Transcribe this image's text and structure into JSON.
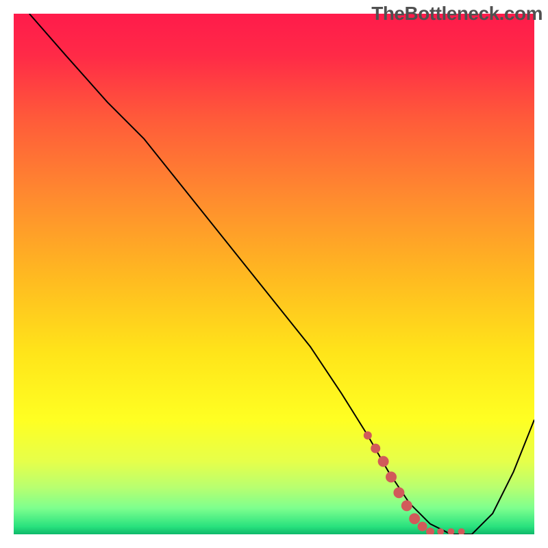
{
  "watermark": "TheBottleneck.com",
  "chart_data": {
    "type": "line",
    "title": "",
    "xlabel": "",
    "ylabel": "",
    "xlim": [
      0,
      100
    ],
    "ylim": [
      0,
      100
    ],
    "gradient_stops": [
      {
        "offset": 0.0,
        "color": "#ff1b4b"
      },
      {
        "offset": 0.08,
        "color": "#ff2a47"
      },
      {
        "offset": 0.2,
        "color": "#ff5a3a"
      },
      {
        "offset": 0.35,
        "color": "#ff8a2f"
      },
      {
        "offset": 0.5,
        "color": "#ffb821"
      },
      {
        "offset": 0.65,
        "color": "#ffe41a"
      },
      {
        "offset": 0.78,
        "color": "#ffff22"
      },
      {
        "offset": 0.86,
        "color": "#e6ff4a"
      },
      {
        "offset": 0.91,
        "color": "#b8ff70"
      },
      {
        "offset": 0.95,
        "color": "#7dff8e"
      },
      {
        "offset": 0.985,
        "color": "#29e27e"
      },
      {
        "offset": 1.0,
        "color": "#0db869"
      }
    ],
    "series": [
      {
        "name": "bottleneck-curve",
        "color": "#000000",
        "width": 2,
        "x": [
          3,
          10,
          18,
          25,
          33,
          41,
          49,
          57,
          63,
          68,
          72,
          76,
          80,
          84,
          88,
          92,
          96,
          100
        ],
        "y": [
          100,
          92,
          83,
          76,
          66,
          56,
          46,
          36,
          27,
          19,
          12,
          6,
          2,
          0,
          0,
          4,
          12,
          22
        ]
      }
    ],
    "markers": {
      "name": "highlight-segment",
      "color": "#d15a5a",
      "points": [
        {
          "x": 68,
          "y": 19,
          "r": 6
        },
        {
          "x": 69.5,
          "y": 16.5,
          "r": 7
        },
        {
          "x": 71,
          "y": 14,
          "r": 8
        },
        {
          "x": 72.5,
          "y": 11,
          "r": 8
        },
        {
          "x": 74,
          "y": 8,
          "r": 8
        },
        {
          "x": 75.5,
          "y": 5.5,
          "r": 8
        },
        {
          "x": 77,
          "y": 3,
          "r": 8
        },
        {
          "x": 78.5,
          "y": 1.5,
          "r": 7
        },
        {
          "x": 80,
          "y": 0.5,
          "r": 6
        },
        {
          "x": 82,
          "y": 0.5,
          "r": 5
        },
        {
          "x": 84,
          "y": 0.5,
          "r": 5
        },
        {
          "x": 86,
          "y": 0.5,
          "r": 5
        }
      ]
    }
  }
}
